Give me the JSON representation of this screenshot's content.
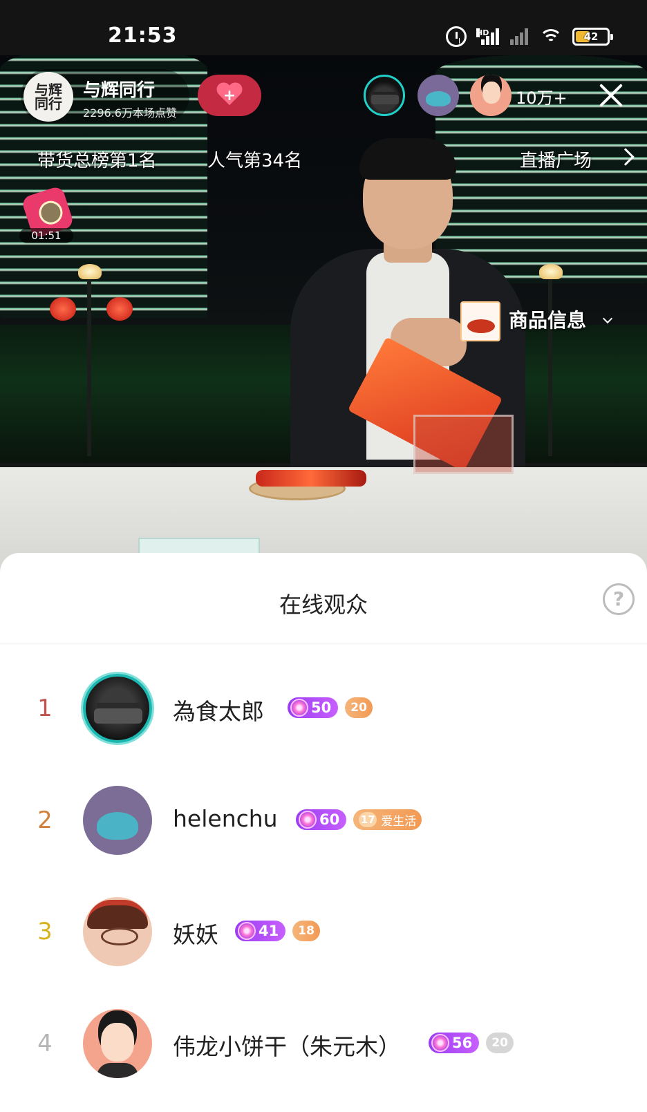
{
  "status_bar": {
    "time": "21:53",
    "network": "HD",
    "battery": "42"
  },
  "live": {
    "host_name": "与辉同行",
    "host_avatar_text": "与辉\n同行",
    "host_likes": "2296.6万本场点赞",
    "viewer_count": "10万+",
    "rank_sales": "带货总榜第1名",
    "rank_popularity": "人气第34名",
    "plaza_link": "直播广场",
    "gift_timer": "01:51",
    "product_info": "商品信息"
  },
  "audience": {
    "title": "在线观众",
    "help": "?",
    "viewers": [
      {
        "rank": "1",
        "name": "為食太郎",
        "level": "50",
        "fan_level": "20",
        "fan_text": ""
      },
      {
        "rank": "2",
        "name": "helenchu",
        "level": "60",
        "fan_level": "17",
        "fan_text": "爱生活"
      },
      {
        "rank": "3",
        "name": "妖妖",
        "level": "41",
        "fan_level": "18",
        "fan_text": ""
      },
      {
        "rank": "4",
        "name": "伟龙小饼干（朱元木）",
        "level": "56",
        "fan_level": "20",
        "fan_text": ""
      }
    ]
  },
  "colors": {
    "follow_button": "#c42b43",
    "level_badge": "#a947f5",
    "fan_badge": "#f29a55",
    "rank1": "#c0534f",
    "rank2": "#d0803c",
    "rank3": "#d7b21f",
    "rank4": "#b5b5b5"
  }
}
